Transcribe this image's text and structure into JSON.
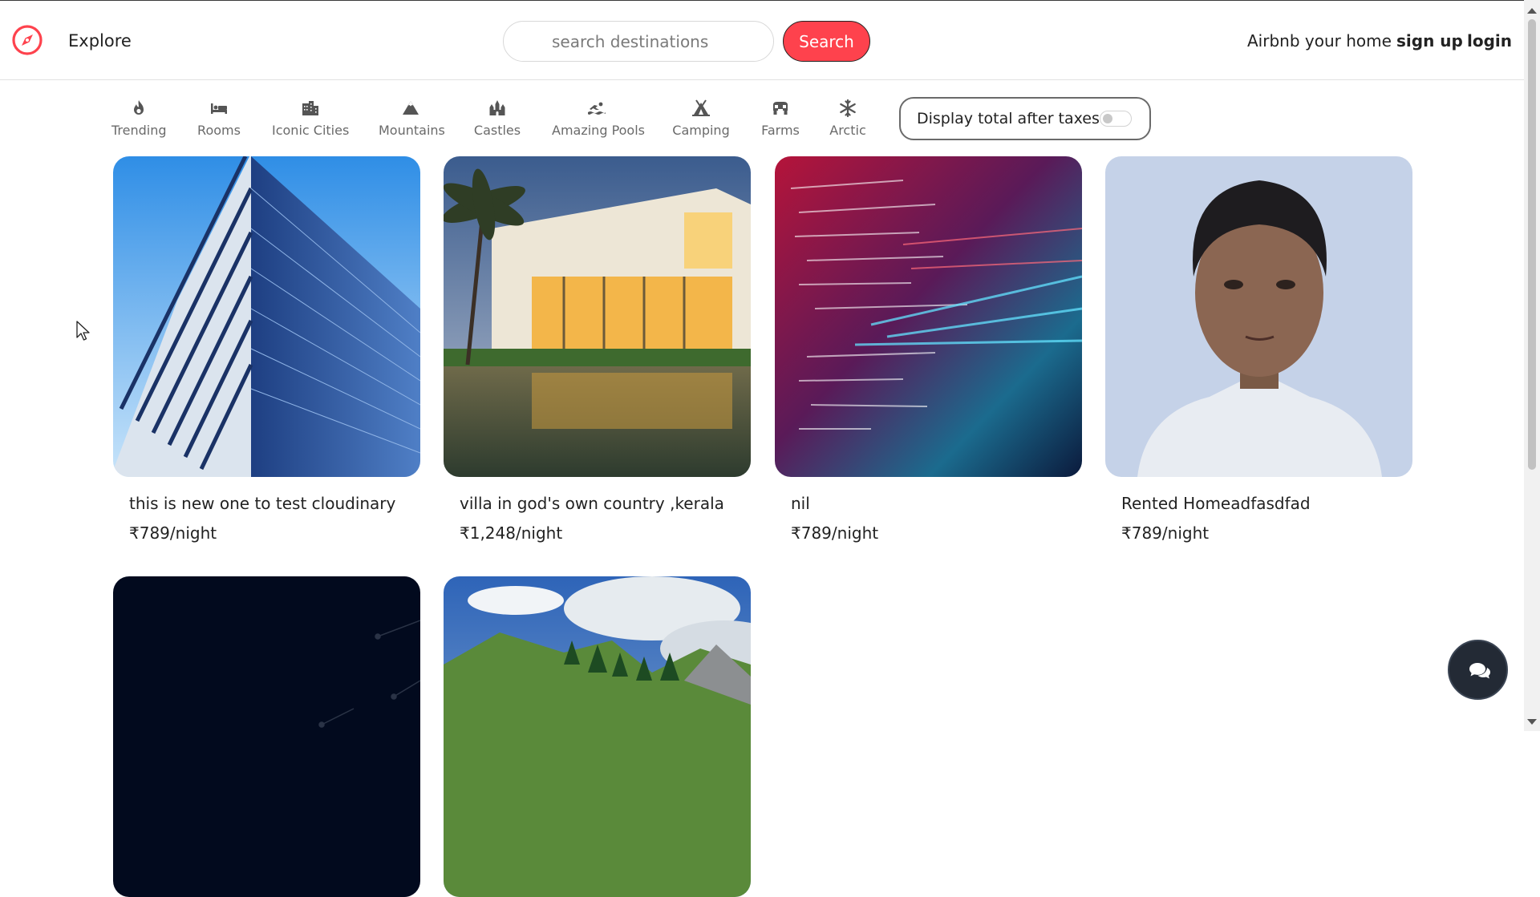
{
  "navbar": {
    "explore_label": "Explore",
    "search": {
      "placeholder": "search destinations",
      "button_label": "Search"
    },
    "host_label": "Airbnb your home",
    "signup_label": "sign up",
    "login_label": "login",
    "brand_color": "#fe424d"
  },
  "filters": [
    {
      "label": "Trending",
      "icon": "fire-icon"
    },
    {
      "label": "Rooms",
      "icon": "bed-icon"
    },
    {
      "label": "Iconic Cities",
      "icon": "city-icon"
    },
    {
      "label": "Mountains",
      "icon": "mountain-icon"
    },
    {
      "label": "Castles",
      "icon": "castle-icon"
    },
    {
      "label": "Amazing Pools",
      "icon": "swimmer-icon"
    },
    {
      "label": "Camping",
      "icon": "campground-icon"
    },
    {
      "label": "Farms",
      "icon": "tractor-icon"
    },
    {
      "label": "Arctic",
      "icon": "snowflake-icon"
    }
  ],
  "tax_toggle": {
    "label": "Display total after taxes",
    "enabled": false
  },
  "listings": [
    {
      "title": "this is new one to test cloudinary",
      "price": "₹789/night"
    },
    {
      "title": "villa in god's own country ,kerala",
      "price": "₹1,248/night"
    },
    {
      "title": "nil",
      "price": "₹789/night"
    },
    {
      "title": "Rented Homeadfasdfad",
      "price": "₹789/night"
    },
    {
      "title": "",
      "price": ""
    },
    {
      "title": "",
      "price": ""
    }
  ],
  "chat": {
    "icon": "comments-icon"
  }
}
